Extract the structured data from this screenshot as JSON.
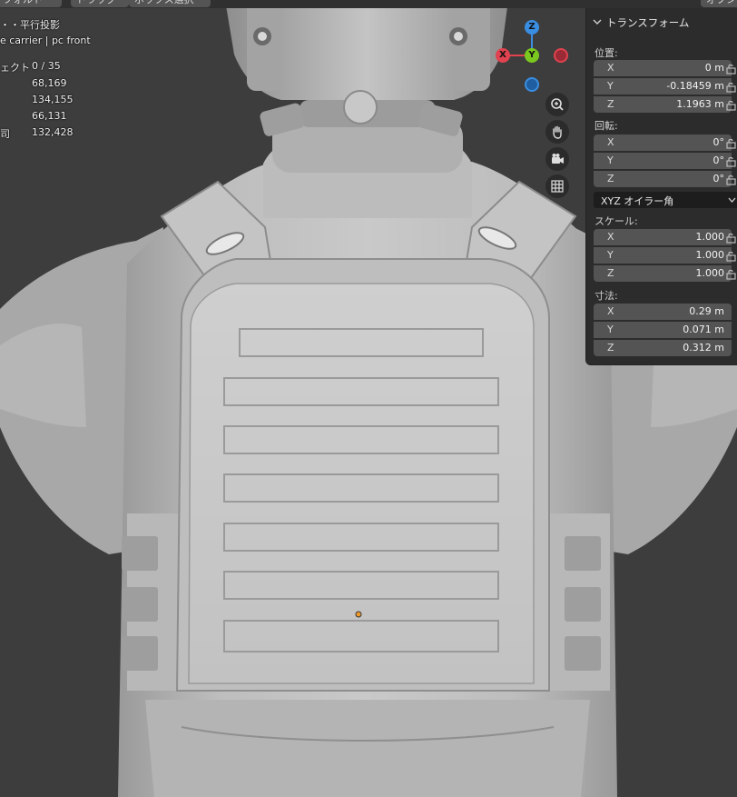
{
  "header": {
    "chips": [
      "デフォルト",
      "ドラッグ",
      "ボックス選択",
      "オプション"
    ]
  },
  "overlay": {
    "view_name": "・・平行投影",
    "collection": "e carrier | pc front",
    "stats": [
      {
        "label": "ェクト",
        "value": "0 / 35"
      },
      {
        "label": "",
        "value": "68,169"
      },
      {
        "label": "",
        "value": "134,155"
      },
      {
        "label": "",
        "value": "66,131"
      },
      {
        "label": "司",
        "value": "132,428"
      }
    ]
  },
  "gizmo": {
    "z": "Z",
    "x": "X",
    "y": "Y",
    "colors": {
      "x": "#e0424f",
      "y": "#7ac81f",
      "z": "#3a8ee2",
      "neg_x": "#9a2a35",
      "neg_z": "#1f5ea0"
    }
  },
  "nav_icons": [
    "zoom-icon",
    "pan-hand-icon",
    "camera-icon",
    "grid-icon"
  ],
  "panel": {
    "title": "トランスフォーム",
    "location_label": "位置:",
    "location": [
      {
        "axis": "X",
        "value": "0 m"
      },
      {
        "axis": "Y",
        "value": "-0.18459 m"
      },
      {
        "axis": "Z",
        "value": "1.1963 m"
      }
    ],
    "rotation_label": "回転:",
    "rotation": [
      {
        "axis": "X",
        "value": "0°"
      },
      {
        "axis": "Y",
        "value": "0°"
      },
      {
        "axis": "Z",
        "value": "0°"
      }
    ],
    "rotation_mode": "XYZ オイラー角",
    "scale_label": "スケール:",
    "scale": [
      {
        "axis": "X",
        "value": "1.000"
      },
      {
        "axis": "Y",
        "value": "1.000"
      },
      {
        "axis": "Z",
        "value": "1.000"
      }
    ],
    "dimensions_label": "寸法:",
    "dimensions": [
      {
        "axis": "X",
        "value": "0.29 m"
      },
      {
        "axis": "Y",
        "value": "0.071 m"
      },
      {
        "axis": "Z",
        "value": "0.312 m"
      }
    ]
  }
}
